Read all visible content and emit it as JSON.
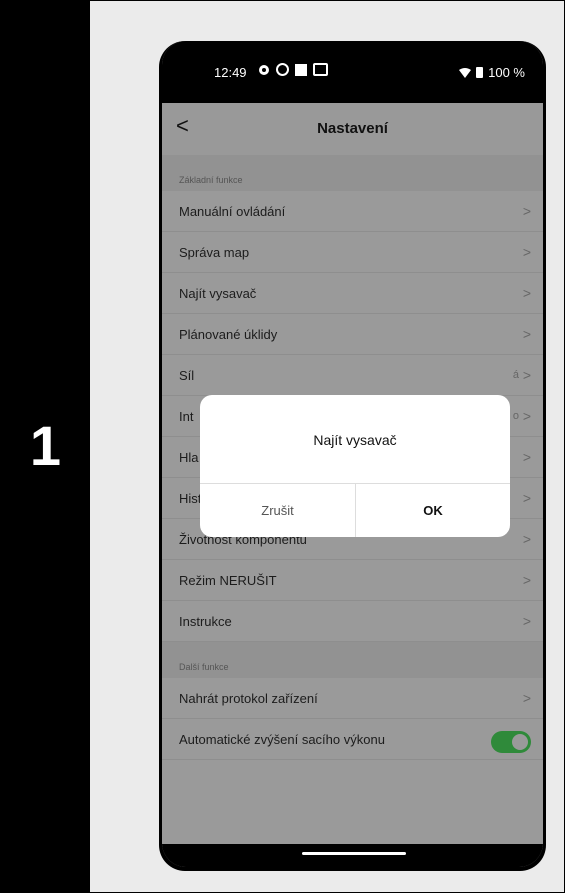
{
  "step_number": "1",
  "status_bar": {
    "time": "12:49",
    "battery": "100 %"
  },
  "header": {
    "back_glyph": "<",
    "title": "Nastavení"
  },
  "sections": [
    {
      "label": "Základní funkce",
      "items": [
        {
          "label": "Manuální ovládání"
        },
        {
          "label": "Správa map"
        },
        {
          "label": "Najít vysavač"
        },
        {
          "label": "Plánované úklidy"
        },
        {
          "label": "Síl",
          "trailing": "á"
        },
        {
          "label": "Int",
          "trailing": "o"
        },
        {
          "label": "Hla"
        },
        {
          "label": "Historie úklidů"
        },
        {
          "label": "Životnost komponentů"
        },
        {
          "label": "Režim NERUŠIT"
        },
        {
          "label": "Instrukce"
        }
      ]
    },
    {
      "label": "Další funkce",
      "items": [
        {
          "label": "Nahrát protokol zařízení"
        },
        {
          "label": "Automatické zvýšení sacího výkonu",
          "toggle_on": true
        }
      ]
    }
  ],
  "dialog": {
    "title": "Najít vysavač",
    "cancel_label": "Zrušit",
    "ok_label": "OK"
  },
  "colors": {
    "overlay_gray": "#9a9a9a",
    "toggle_green": "#2f8a3a"
  }
}
